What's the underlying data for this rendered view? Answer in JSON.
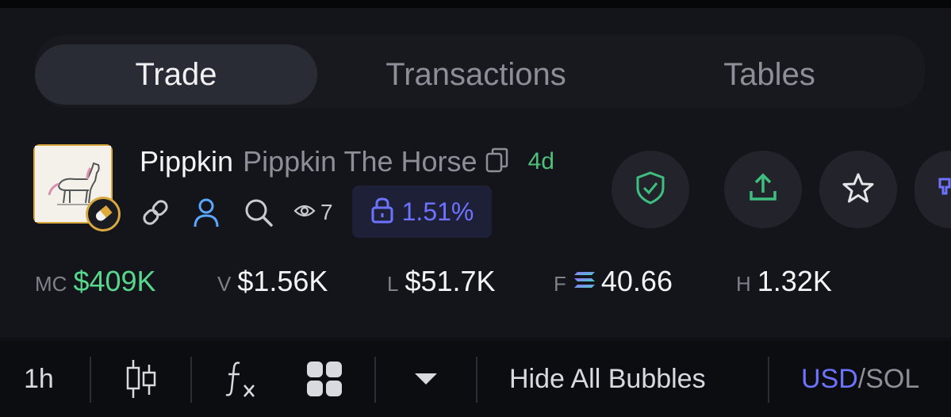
{
  "tabs": [
    {
      "label": "Trade",
      "active": true
    },
    {
      "label": "Transactions",
      "active": false
    },
    {
      "label": "Tables",
      "active": false
    }
  ],
  "token": {
    "ticker": "Pippkin",
    "name": "Pippkin The Horse",
    "age": "4d",
    "watchers": "7",
    "locked_pct": "1.51%"
  },
  "icons": {
    "logo": "horse-logo-icon",
    "badge": "pill-icon",
    "copy": "copy-icon",
    "link": "link-icon",
    "dev": "user-icon",
    "search": "search-icon",
    "views": "eye-icon",
    "lock": "lock-icon"
  },
  "actions": [
    {
      "name": "shield-check-icon",
      "color": "#3fbf7f"
    },
    {
      "name": "share-icon",
      "color": "#3fbf7f"
    },
    {
      "name": "star-icon",
      "color": "#e6e6ea"
    },
    {
      "name": "partial-action-icon",
      "color": "#6d73ff"
    }
  ],
  "stats": {
    "mc": {
      "label": "MC",
      "value": "$409K"
    },
    "v": {
      "label": "V",
      "value": "$1.56K"
    },
    "l": {
      "label": "L",
      "value": "$51.7K"
    },
    "f": {
      "label": "F",
      "value": "40.66"
    },
    "h": {
      "label": "H",
      "value": "1.32K"
    }
  },
  "toolbar": {
    "interval": "1h",
    "bubbles": "Hide All Bubbles",
    "currency_usd": "USD",
    "separator": "/",
    "currency_sol": "SOL"
  },
  "colors": {
    "accent_green": "#58d68d",
    "accent_blue": "#6d73ff",
    "logo_border": "#d9a93f"
  }
}
